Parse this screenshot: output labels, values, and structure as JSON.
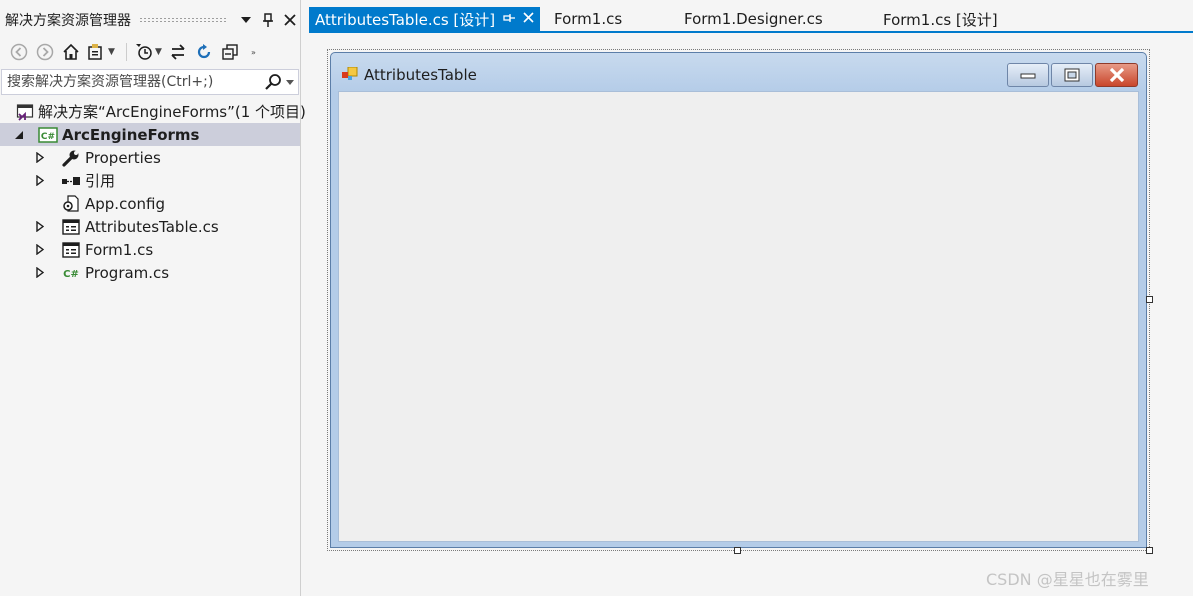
{
  "solution_explorer": {
    "title": "解决方案资源管理器",
    "search_placeholder": "搜索解决方案资源管理器(Ctrl+;)",
    "solution_label": "解决方案“ArcEngineForms”(1 个项目)",
    "project_label": "ArcEngineForms",
    "items": [
      {
        "label": "Properties",
        "icon": "wrench-icon",
        "expandable": true
      },
      {
        "label": "引用",
        "icon": "references-icon",
        "expandable": true
      },
      {
        "label": "App.config",
        "icon": "config-file-icon",
        "expandable": false
      },
      {
        "label": "AttributesTable.cs",
        "icon": "form-file-icon",
        "expandable": true
      },
      {
        "label": "Form1.cs",
        "icon": "form-file-icon",
        "expandable": true
      },
      {
        "label": "Program.cs",
        "icon": "csharp-file-icon",
        "expandable": true
      }
    ]
  },
  "tabs": [
    {
      "label": "AttributesTable.cs [设计]",
      "active": true
    },
    {
      "label": "Form1.cs",
      "active": false
    },
    {
      "label": "Form1.Designer.cs",
      "active": false
    },
    {
      "label": "Form1.cs [设计]",
      "active": false
    }
  ],
  "form": {
    "title": "AttributesTable"
  },
  "watermark": "CSDN @星星也在雾里",
  "colors": {
    "accent": "#007acc",
    "selected_row": "#cccedb",
    "form_client": "#efefef",
    "close_button": "#c9462c"
  }
}
